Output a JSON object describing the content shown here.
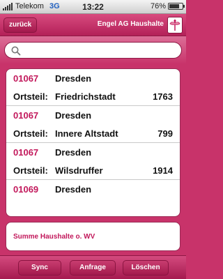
{
  "status_bar": {
    "carrier": "Telekom",
    "network": "3G",
    "time": "13:22",
    "battery": "76%",
    "battery_level": 0.76
  },
  "nav": {
    "back_label": "zurück",
    "title": "Engel AG Haushalte"
  },
  "search": {
    "value": "",
    "placeholder": ""
  },
  "list": {
    "items": [
      {
        "plz": "01067",
        "city": "Dresden",
        "district_label": "Ortsteil:",
        "district": "Friedrichstadt",
        "count": "1763"
      },
      {
        "plz": "01067",
        "city": "Dresden",
        "district_label": "Ortsteil:",
        "district": "Innere Altstadt",
        "count": "799"
      },
      {
        "plz": "01067",
        "city": "Dresden",
        "district_label": "Ortsteil:",
        "district": "Wilsdruffer",
        "count": "1914"
      },
      {
        "plz": "01069",
        "city": "Dresden"
      }
    ]
  },
  "summary": {
    "label": "Summe Haushalte o. WV"
  },
  "toolbar": {
    "sync_label": "Sync",
    "request_label": "Anfrage",
    "delete_label": "Löschen"
  },
  "colors": {
    "brand": "#c8336a",
    "accent_text": "#c2185b"
  },
  "icons": {
    "search": "search-icon",
    "logo": "logo-icon"
  }
}
